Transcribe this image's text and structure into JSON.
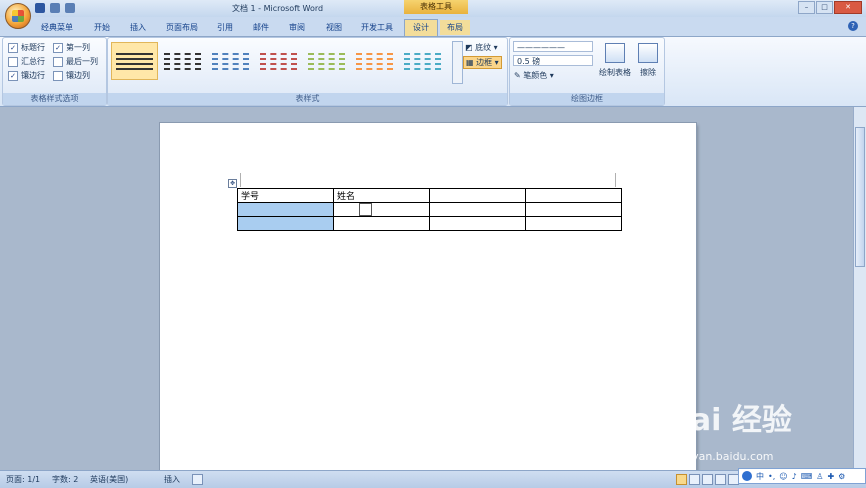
{
  "titlebar": {
    "doc_title": "文档 1 - Microsoft Word",
    "context_title": "表格工具",
    "window_buttons": [
      "–",
      "□",
      "✕"
    ]
  },
  "tabs": [
    "经典菜单",
    "开始",
    "插入",
    "页面布局",
    "引用",
    "邮件",
    "审阅",
    "视图",
    "开发工具",
    "设计",
    "布局"
  ],
  "active_tab": "设计",
  "ribbon": {
    "options_group": {
      "label": "表格样式选项",
      "items": [
        {
          "label": "标题行",
          "checked": true
        },
        {
          "label": "第一列",
          "checked": true
        },
        {
          "label": "汇总行",
          "checked": false
        },
        {
          "label": "最后一列",
          "checked": false
        },
        {
          "label": "镶边行",
          "checked": true
        },
        {
          "label": "镶边列",
          "checked": false
        }
      ]
    },
    "styles_group": {
      "label": "表样式",
      "shading": "底纹",
      "borders": "边框",
      "swatch_colors": [
        "#333333",
        "#333333",
        "#4f81bd",
        "#c0504d",
        "#9bbb59",
        "#f79646",
        "#4bacc6",
        "#8064a2"
      ]
    },
    "draw_group": {
      "label": "绘图边框",
      "line_style": "——————",
      "line_weight": "0.5 磅",
      "pen_color": "笔颜色",
      "draw_table": "绘制表格",
      "eraser": "擦除"
    }
  },
  "document": {
    "table": [
      [
        "学号",
        "姓名",
        "",
        ""
      ],
      [
        "",
        "",
        "",
        ""
      ],
      [
        "",
        "",
        "",
        ""
      ]
    ]
  },
  "status": {
    "page": "页面: 1/1",
    "words": "字数: 2",
    "language": "英语(美国)",
    "mode": "插入"
  },
  "watermark": {
    "brand": "Bai 经验",
    "url": "jingyan.baidu.com"
  },
  "ime": {
    "lang": "中"
  }
}
